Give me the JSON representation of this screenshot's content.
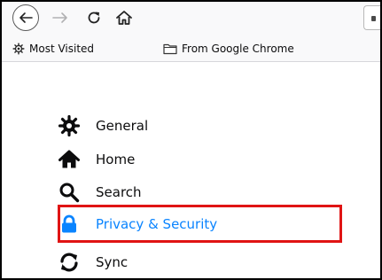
{
  "toolbar": {
    "buttons": [
      {
        "name": "back",
        "icon": "back-arrow-icon"
      },
      {
        "name": "forward",
        "icon": "forward-arrow-icon"
      },
      {
        "name": "reload",
        "icon": "reload-icon"
      },
      {
        "name": "home",
        "icon": "home-icon"
      }
    ]
  },
  "bookmarks": {
    "items": [
      {
        "label": "Most Visited",
        "icon": "gear-icon"
      },
      {
        "label": "From Google Chrome",
        "icon": "folder-icon"
      }
    ]
  },
  "categories": {
    "items": [
      {
        "label": "General",
        "icon": "gear-icon",
        "selected": false
      },
      {
        "label": "Home",
        "icon": "home-icon",
        "selected": false
      },
      {
        "label": "Search",
        "icon": "search-icon",
        "selected": false
      },
      {
        "label": "Privacy & Security",
        "icon": "lock-icon",
        "selected": true
      },
      {
        "label": "Sync",
        "icon": "sync-icon",
        "selected": false
      }
    ]
  },
  "colors": {
    "selected": "#0a84ff",
    "highlight_border": "#e01414",
    "text": "#0c0c0d"
  }
}
